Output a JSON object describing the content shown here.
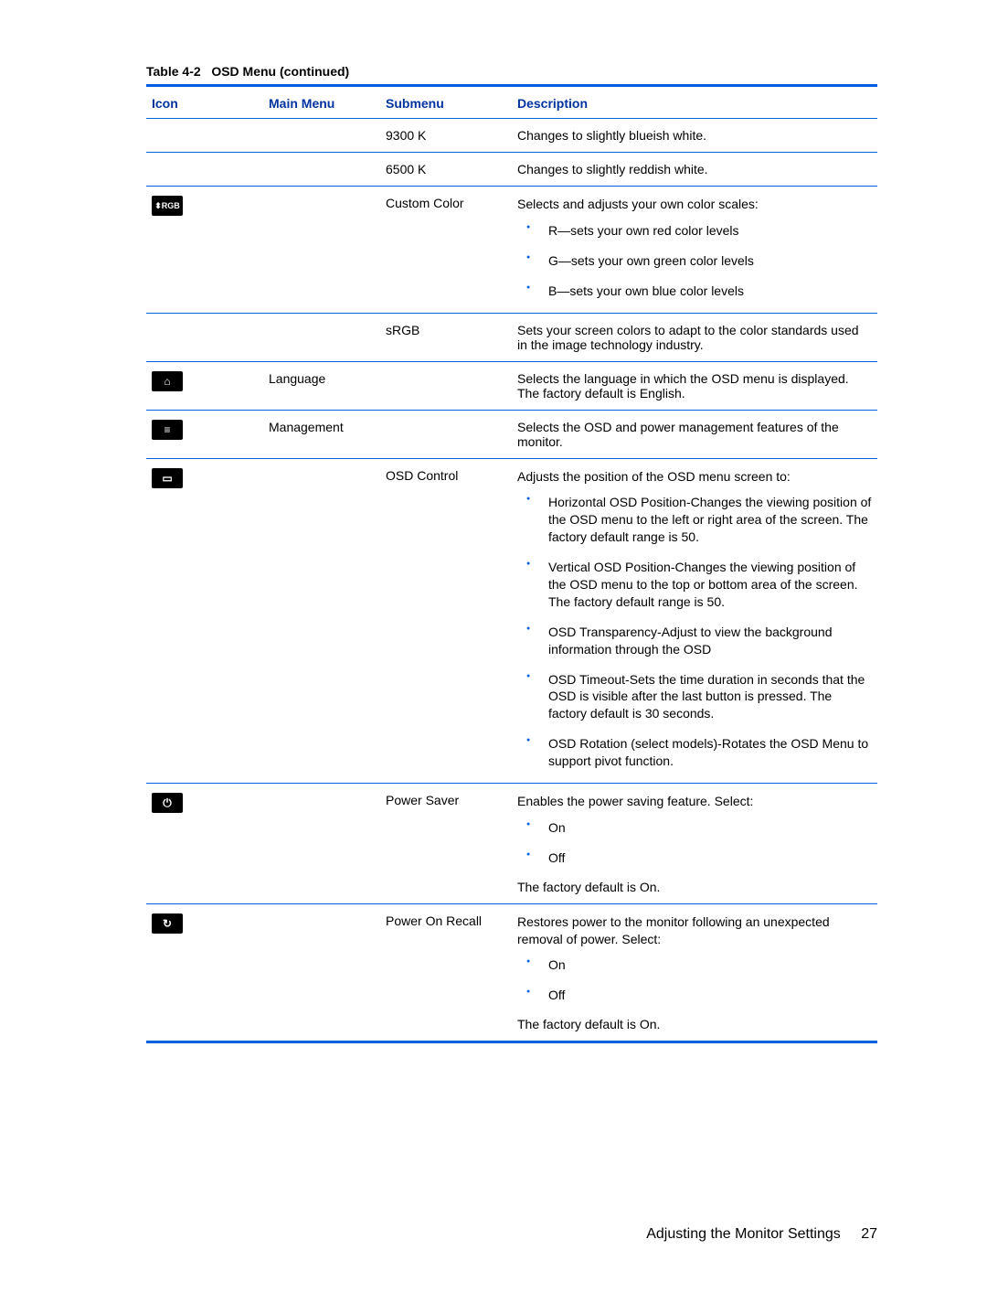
{
  "caption": {
    "label": "Table 4-2",
    "title": "OSD Menu (continued)"
  },
  "headers": {
    "icon": "Icon",
    "main": "Main Menu",
    "sub": "Submenu",
    "desc": "Description"
  },
  "rows": {
    "r0": {
      "sub": "9300 K",
      "desc": "Changes to slightly blueish white."
    },
    "r1": {
      "sub": "6500 K",
      "desc": "Changes to slightly reddish white."
    },
    "r2": {
      "icon_text": "RGB",
      "sub": "Custom Color",
      "desc_lead": "Selects and adjusts your own color scales:",
      "bullets": [
        "R—sets your own red color levels",
        "G—sets your own green color levels",
        "B—sets your own blue color levels"
      ]
    },
    "r3": {
      "sub": "sRGB",
      "desc": "Sets your screen colors to adapt to the color standards used in the image technology industry."
    },
    "r4": {
      "icon_glyph": "⌂",
      "main": "Language",
      "desc": "Selects the language in which the OSD menu is displayed. The factory default is English."
    },
    "r5": {
      "icon_glyph": "≡",
      "main": "Management",
      "desc": "Selects the OSD and power management features of the monitor."
    },
    "r6": {
      "icon_glyph": "▭",
      "sub": "OSD Control",
      "desc_lead": "Adjusts the position of the OSD menu screen to:",
      "bullets": [
        "Horizontal OSD Position-Changes the viewing position of the OSD menu to the left or right area of the screen. The factory default range is 50.",
        "Vertical OSD Position-Changes the viewing position of the OSD menu to the top or bottom area of the screen. The factory default range is 50.",
        "OSD Transparency-Adjust to view the background information through the OSD",
        "OSD Timeout-Sets the time duration in seconds that the OSD is visible after the last button is pressed. The factory default is 30 seconds.",
        "OSD Rotation (select models)-Rotates the OSD Menu to support pivot function."
      ]
    },
    "r7": {
      "icon_glyph": "⏻",
      "sub": "Power Saver",
      "desc_lead": "Enables the power saving feature. Select:",
      "bullets": [
        "On",
        "Off"
      ],
      "desc_tail": "The factory default is On."
    },
    "r8": {
      "icon_glyph": "↻",
      "sub": "Power On Recall",
      "desc_lead": "Restores power to the monitor following an unexpected removal of power. Select:",
      "bullets": [
        "On",
        "Off"
      ],
      "desc_tail": "The factory default is On."
    }
  },
  "footer": {
    "section": "Adjusting the Monitor Settings",
    "page": "27"
  }
}
